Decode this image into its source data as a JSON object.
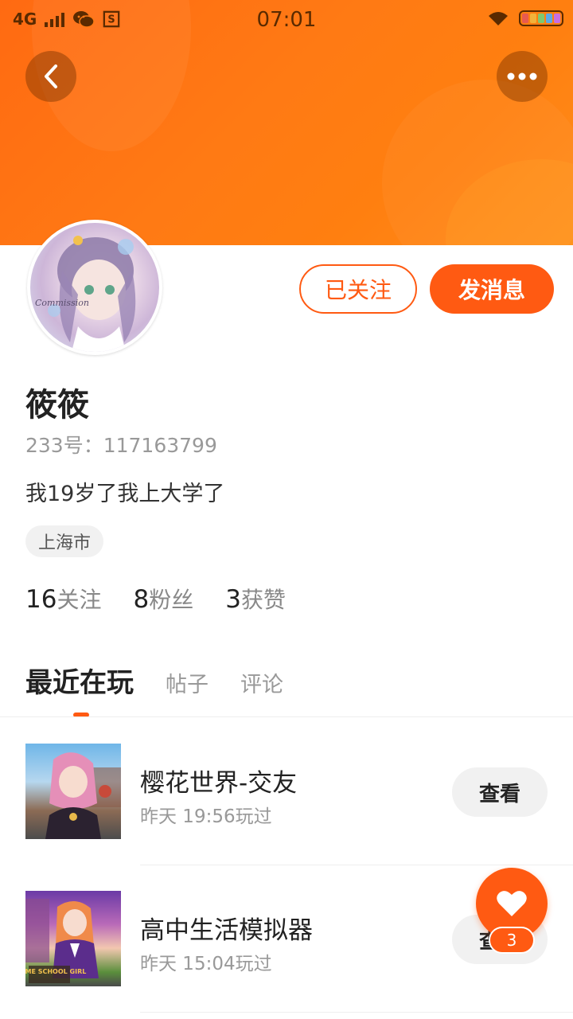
{
  "status_bar": {
    "network": "4G",
    "time": "07:01",
    "icons": [
      "signal-icon",
      "wechat-icon",
      "s-app-icon",
      "wifi-icon",
      "battery-icon"
    ]
  },
  "header": {
    "back_icon": "chevron-left-icon",
    "more_icon": "more-dots-icon",
    "colors": {
      "gradient_start": "#ff6a12",
      "gradient_end": "#ff8d1a"
    }
  },
  "profile": {
    "avatar_watermark": "Commission",
    "follow_label": "已关注",
    "message_label": "发消息",
    "name": "筱筱",
    "id_text": "233号：117163799",
    "bio": "我19岁了我上大学了",
    "location": "上海市",
    "stats": [
      {
        "count": "16",
        "label": "关注"
      },
      {
        "count": "8",
        "label": "粉丝"
      },
      {
        "count": "3",
        "label": "获赞"
      }
    ]
  },
  "tabs": [
    {
      "label": "最近在玩",
      "active": true
    },
    {
      "label": "帖子",
      "active": false
    },
    {
      "label": "评论",
      "active": false
    }
  ],
  "recent_games": [
    {
      "title": "樱花世界-交友",
      "played": "昨天 19:56玩过",
      "action": "查看"
    },
    {
      "title": "高中生活模拟器",
      "played": "昨天 15:04玩过",
      "action": "查看",
      "thumb_text": "ANIME SCHOOL GIRL"
    }
  ],
  "fab": {
    "icon": "heart-icon",
    "badge": "3"
  },
  "accent_color": "#ff5a12"
}
